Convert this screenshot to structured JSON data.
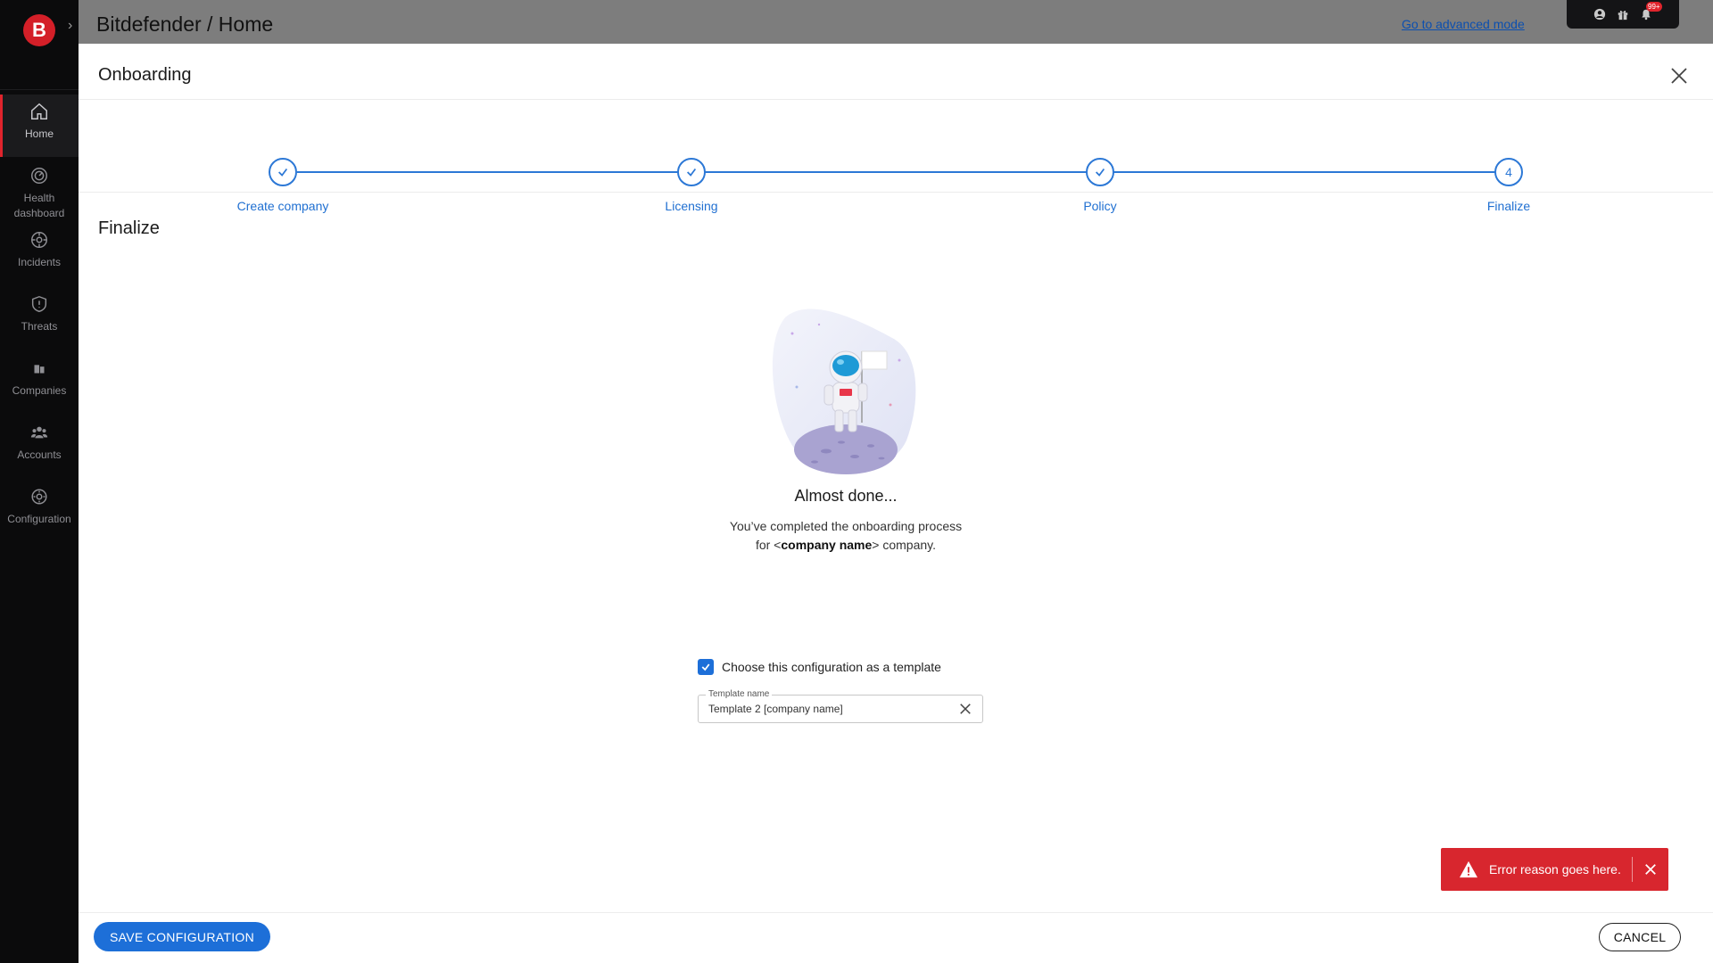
{
  "sidebar": {
    "logo_letter": "B",
    "items": [
      {
        "label": "Home",
        "icon": "home-icon"
      },
      {
        "label": "Health dashboard",
        "icon": "health-icon"
      },
      {
        "label": "Incidents",
        "icon": "incidents-icon"
      },
      {
        "label": "Threats",
        "icon": "shield-icon"
      },
      {
        "label": "Companies",
        "icon": "companies-icon"
      },
      {
        "label": "Accounts",
        "icon": "accounts-icon"
      },
      {
        "label": "Configuration",
        "icon": "gear-icon"
      }
    ]
  },
  "header": {
    "title": "Bitdefender / Home",
    "advanced_link": "Go to advanced mode",
    "notification_badge": "99+"
  },
  "modal": {
    "title": "Onboarding",
    "steps": [
      {
        "label": "Create company",
        "state": "complete"
      },
      {
        "label": "Licensing",
        "state": "complete"
      },
      {
        "label": "Policy",
        "state": "complete"
      },
      {
        "label": "Finalize",
        "state": "current",
        "number": "4"
      }
    ],
    "section_title": "Finalize",
    "almost_done": "Almost done...",
    "done_line1": "You’ve completed the onboarding process",
    "done_line2_prefix": "for <",
    "done_line2_bold": "company name",
    "done_line2_suffix": "> company.",
    "template_checkbox_label": "Choose this configuration as a template",
    "template_field_label": "Template name",
    "template_field_value": "Template 2 [company name]",
    "error_message": "Error reason goes here.",
    "save_label": "SAVE CONFIGURATION",
    "cancel_label": "CANCEL"
  },
  "colors": {
    "accent": "#1d6fd8",
    "brand": "#d41f28",
    "error": "#d8262e"
  }
}
